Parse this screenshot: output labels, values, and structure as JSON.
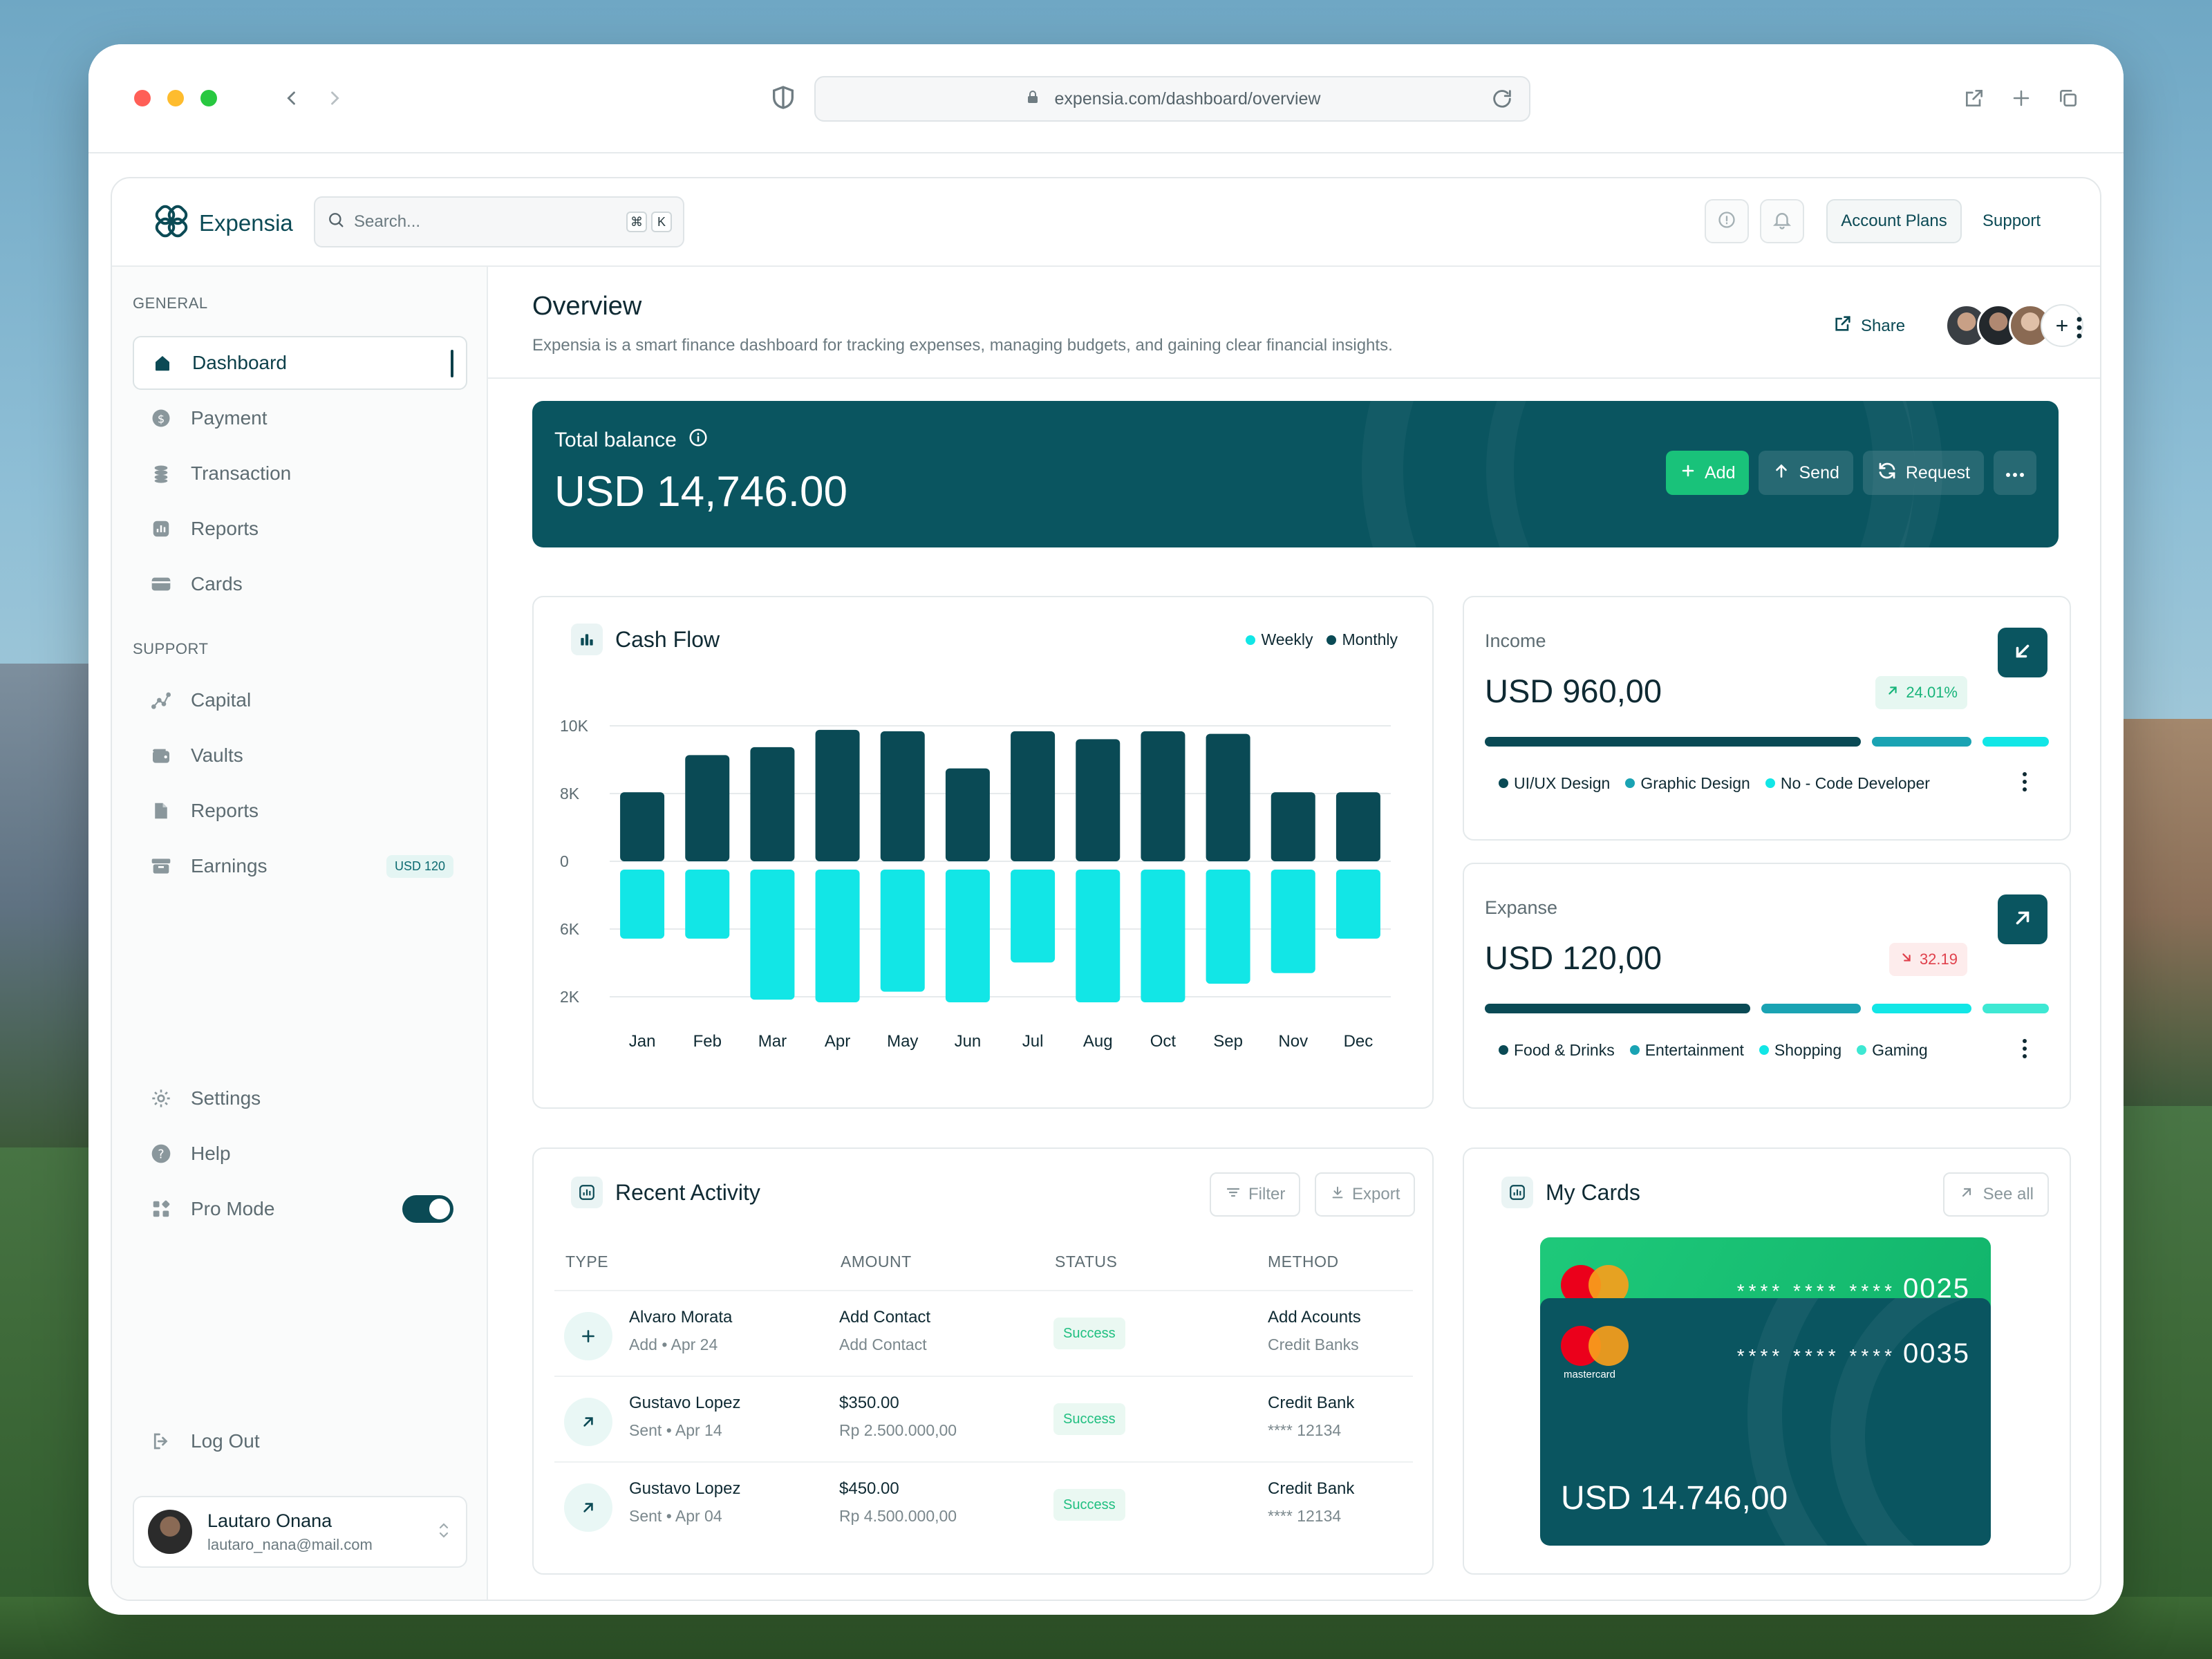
{
  "browser": {
    "url": "expensia.com/dashboard/overview"
  },
  "header": {
    "brand": "Expensia",
    "search_placeholder": "Search...",
    "shortcut_keys": [
      "⌘",
      "K"
    ],
    "account_plans": "Account Plans",
    "support": "Support"
  },
  "sidebar": {
    "general_label": "GENERAL",
    "general_items": [
      {
        "label": "Dashboard",
        "icon": "home-icon",
        "active": true
      },
      {
        "label": "Payment",
        "icon": "dollar-icon"
      },
      {
        "label": "Transaction",
        "icon": "coins-icon"
      },
      {
        "label": "Reports",
        "icon": "chart-icon"
      },
      {
        "label": "Cards",
        "icon": "card-icon"
      }
    ],
    "support_label": "SUPPORT",
    "support_items": [
      {
        "label": "Capital",
        "icon": "graph-icon"
      },
      {
        "label": "Vaults",
        "icon": "wallet-icon"
      },
      {
        "label": "Reports",
        "icon": "file-icon"
      },
      {
        "label": "Earnings",
        "icon": "archive-icon",
        "badge": "USD 120"
      }
    ],
    "bottom_items": [
      {
        "label": "Settings",
        "icon": "gear-icon"
      },
      {
        "label": "Help",
        "icon": "help-icon"
      },
      {
        "label": "Pro Mode",
        "icon": "grid-icon",
        "toggle": true
      }
    ],
    "logout": "Log Out",
    "user": {
      "name": "Lautaro Onana",
      "email": "lautaro_nana@mail.com"
    }
  },
  "overview": {
    "title": "Overview",
    "subtitle": "Expensia is a smart finance dashboard for tracking expenses, managing budgets, and gaining clear financial insights.",
    "share": "Share"
  },
  "balance": {
    "label": "Total balance",
    "value": "USD 14,746.00",
    "actions": {
      "add": "Add",
      "send": "Send",
      "request": "Request"
    }
  },
  "cashflow": {
    "title": "Cash Flow",
    "legend": [
      {
        "name": "Weekly",
        "color": "#12e6e6"
      },
      {
        "name": "Monthly",
        "color": "#0a4a55"
      }
    ]
  },
  "chart_data": {
    "type": "bar",
    "title": "Cash Flow",
    "categories": [
      "Jan",
      "Feb",
      "Mar",
      "Apr",
      "May",
      "Jun",
      "Jul",
      "Aug",
      "Oct",
      "Sep",
      "Nov",
      "Dec"
    ],
    "y_tick_labels": [
      "10K",
      "8K",
      "0",
      "6K",
      "2K"
    ],
    "series": [
      {
        "name": "Monthly",
        "color": "#0a4a55",
        "values": [
          5.2,
          8.0,
          8.6,
          9.9,
          9.8,
          7.0,
          9.8,
          9.2,
          9.8,
          9.6,
          5.2,
          5.2
        ]
      },
      {
        "name": "Weekly",
        "color": "#12e6e6",
        "values": [
          -5.2,
          -5.2,
          -9.8,
          -10.0,
          -9.2,
          -10.0,
          -7.0,
          -10.0,
          -10.0,
          -8.6,
          -7.8,
          -5.2
        ]
      }
    ],
    "ylim": [
      -10.5,
      10.5
    ],
    "grid": true,
    "legend_position": "top-right"
  },
  "income": {
    "label": "Income",
    "value": "USD 960,00",
    "change": "24.01%",
    "segments": [
      {
        "color": "#0a4a55",
        "share": 0.68
      },
      {
        "color": "#1aa3b3",
        "share": 0.18
      },
      {
        "color": "#12e6e6",
        "share": 0.12
      }
    ],
    "legend": [
      {
        "name": "UI/UX Design",
        "color": "#0a4a55"
      },
      {
        "name": "Graphic Design",
        "color": "#1aa3b3"
      },
      {
        "name": "No - Code Developer",
        "color": "#12e6e6"
      }
    ]
  },
  "expense": {
    "label": "Expanse",
    "value": "USD 120,00",
    "change": "32.19",
    "segments": [
      {
        "color": "#0a4a55",
        "share": 0.48
      },
      {
        "color": "#1aa3b3",
        "share": 0.18
      },
      {
        "color": "#12e6e6",
        "share": 0.18
      },
      {
        "color": "#3ee8d3",
        "share": 0.12
      }
    ],
    "legend": [
      {
        "name": "Food & Drinks",
        "color": "#0a4a55"
      },
      {
        "name": "Entertainment",
        "color": "#1aa3b3"
      },
      {
        "name": "Shopping",
        "color": "#12e6e6"
      },
      {
        "name": "Gaming",
        "color": "#3ee8d3"
      }
    ]
  },
  "activity": {
    "title": "Recent Activity",
    "filter": "Filter",
    "export": "Export",
    "columns": [
      "TYPE",
      "AMOUNT",
      "STATUS",
      "METHOD"
    ],
    "rows": [
      {
        "icon": "plus-icon",
        "name": "Alvaro Morata",
        "meta": "Add • Apr 24",
        "amount": "Add Contact",
        "amount_sub": "Add Contact",
        "status": "Success",
        "method": "Add Acounts",
        "method_sub": "Credit Banks"
      },
      {
        "icon": "arrow-up-right-icon",
        "name": "Gustavo Lopez",
        "meta": "Sent • Apr 14",
        "amount": "$350.00",
        "amount_sub": "Rp 2.500.000,00",
        "status": "Success",
        "method": "Credit Bank",
        "method_sub": "**** 12134"
      },
      {
        "icon": "arrow-up-right-icon",
        "name": "Gustavo Lopez",
        "meta": "Sent • Apr 04",
        "amount": "$450.00",
        "amount_sub": "Rp 4.500.000,00",
        "status": "Success",
        "method": "Credit Bank",
        "method_sub": "**** 12134"
      }
    ]
  },
  "mycards": {
    "title": "My Cards",
    "see_all": "See all",
    "back_card": {
      "stars": "**** **** ****",
      "last4": "0025"
    },
    "front_card": {
      "brand": "mastercard",
      "stars": "**** **** ****",
      "last4": "0035",
      "balance": "USD 14.746,00"
    }
  }
}
